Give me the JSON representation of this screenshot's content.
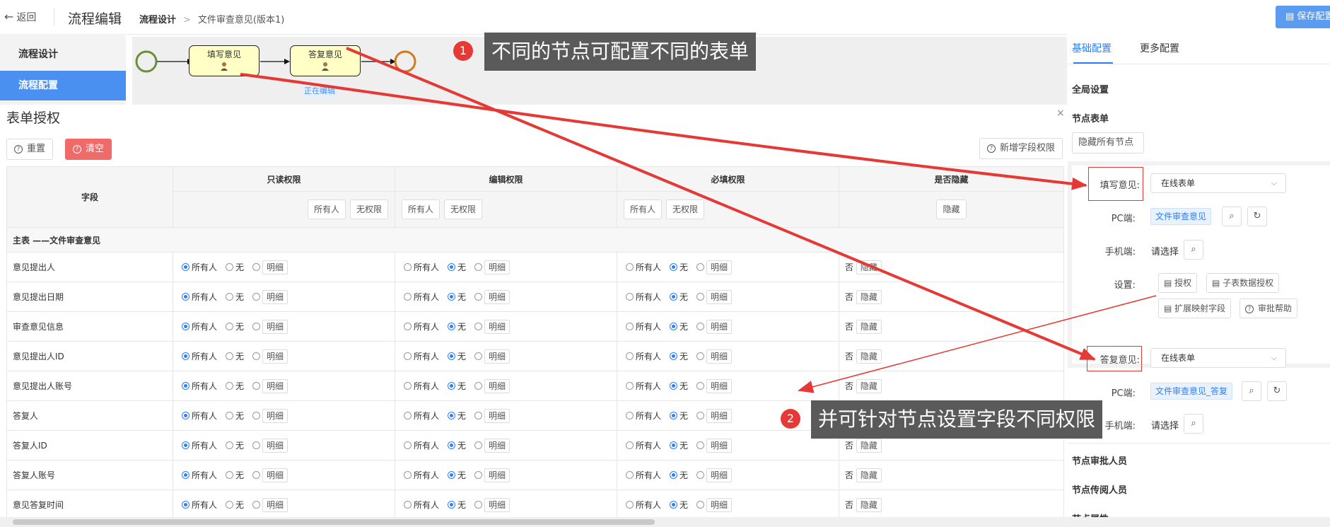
{
  "topbar": {
    "back_label": "返回",
    "title": "流程编辑",
    "breadcrumb": [
      "流程设计",
      "文件审查意见(版本1)"
    ],
    "save_label": "保存配置"
  },
  "leftnav": {
    "items": [
      {
        "label": "流程设计",
        "active": false
      },
      {
        "label": "流程配置",
        "active": true
      }
    ]
  },
  "flow": {
    "nodes": [
      "填写意见",
      "答复意见"
    ],
    "editing_label": "正在编辑"
  },
  "callouts": [
    {
      "number": "1",
      "text": "不同的节点可配置不同的表单"
    },
    {
      "number": "2",
      "text": "并可针对节点设置字段不同权限"
    }
  ],
  "form": {
    "title": "表单授权",
    "close": "×",
    "reset_label": "重置",
    "clear_label": "清空",
    "add_field_label": "新增字段权限",
    "columns": {
      "field": "字段",
      "readonly": "只读权限",
      "edit": "编辑权限",
      "required": "必填权限",
      "hidden": "是否隐藏"
    },
    "header_buttons": {
      "all": "所有人",
      "none": "无权限",
      "hide": "隐藏"
    },
    "group_label": "主表 ——文件审查意见",
    "option_all": "所有人",
    "option_none": "无",
    "detail_label": "明细",
    "no_label": "否",
    "hide_label": "隐藏",
    "rows": [
      "意见提出人",
      "意见提出日期",
      "审查意见信息",
      "意见提出人ID",
      "意见提出人账号",
      "答复人",
      "答复人ID",
      "答复人账号",
      "意见答复时间"
    ]
  },
  "right_panel": {
    "tabs": [
      "基础配置",
      "更多配置"
    ],
    "global_settings": "全局设置",
    "node_form": "节点表单",
    "hide_all_nodes": "隐藏所有节点",
    "node1": {
      "label": "填写意见:",
      "form_type": "在线表单",
      "pc_label": "PC端:",
      "pc_value": "文件审查意见",
      "mobile_label": "手机端:",
      "mobile_value": "请选择",
      "settings_label": "设置:",
      "buttons": [
        "授权",
        "子表数据授权",
        "扩展映射字段",
        "审批帮助"
      ]
    },
    "node2": {
      "label": "答复意见:",
      "form_type": "在线表单",
      "pc_label": "PC端:",
      "pc_value": "文件审查意见_答复",
      "mobile_label": "手机端:",
      "mobile_value": "请选择"
    },
    "sections": [
      "节点审批人员",
      "节点传阅人员",
      "节点属性"
    ]
  }
}
